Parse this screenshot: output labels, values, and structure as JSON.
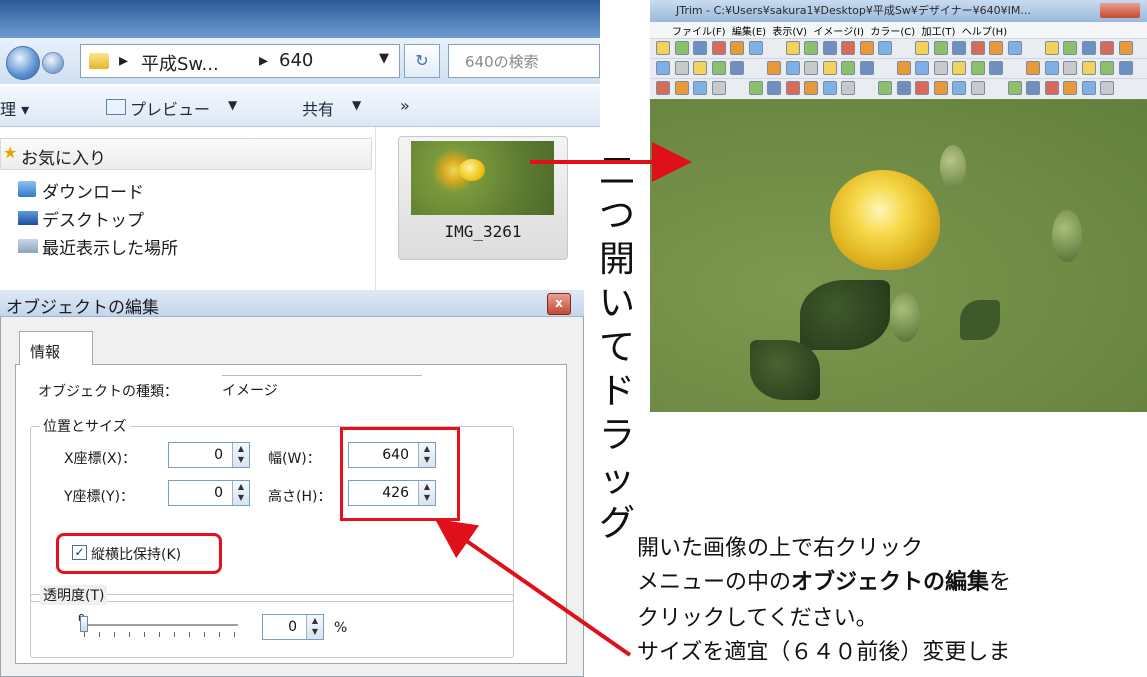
{
  "explorer": {
    "breadcrumb": [
      "平成Sw...",
      "640"
    ],
    "search_placeholder": "640の検索",
    "toolbar": {
      "organize": "理 ▾",
      "preview": "プレビュー",
      "share": "共有",
      "more": "»"
    },
    "nav": {
      "favorites": "お気に入り",
      "downloads": "ダウンロード",
      "desktop": "デスクトップ",
      "recent": "最近表示した場所"
    },
    "file": {
      "name": "IMG_3261"
    }
  },
  "dialog": {
    "title": "オブジェクトの編集",
    "close_label": "x",
    "tab": "情報",
    "object_type_label": "オブジェクトの種類：",
    "object_type_value": "イメージ",
    "group_position_size": "位置とサイズ",
    "x_label": "X座標(X)：",
    "x_value": "0",
    "y_label": "Y座標(Y)：",
    "y_value": "0",
    "width_label": "幅(W)：",
    "width_value": "640",
    "height_label": "高さ(H)：",
    "height_value": "426",
    "keep_ratio_label": "縦横比保持(K)",
    "keep_ratio_checked": true,
    "group_transparency": "透明度(T)",
    "slider_min_label": "0",
    "transparency_value": "0",
    "transparency_unit": "%"
  },
  "jtrim": {
    "title": "JTrim - C:¥Users¥sakura1¥Desktop¥平成Sw¥デザイナー¥640¥IM...",
    "menu": [
      "ファイル(F)",
      "編集(E)",
      "表示(V)",
      "イメージ(I)",
      "カラー(C)",
      "加工(T)",
      "ヘルプ(H)"
    ]
  },
  "annotation": {
    "vertical": [
      "二",
      "つ",
      "開",
      "い",
      "て",
      "ド",
      "ラ",
      "ッ",
      "グ"
    ],
    "line1": "開いた画像の上で右クリック",
    "line2_pre": "メニューの中の",
    "line2_bold": "オブジェクトの編集",
    "line2_post": "を",
    "line3": "クリックしてください。",
    "line4": "サイズを適宜（６４０前後）変更しま"
  },
  "colors": {
    "highlight_red": "#e8101c",
    "arrow_red": "#e0101a"
  }
}
